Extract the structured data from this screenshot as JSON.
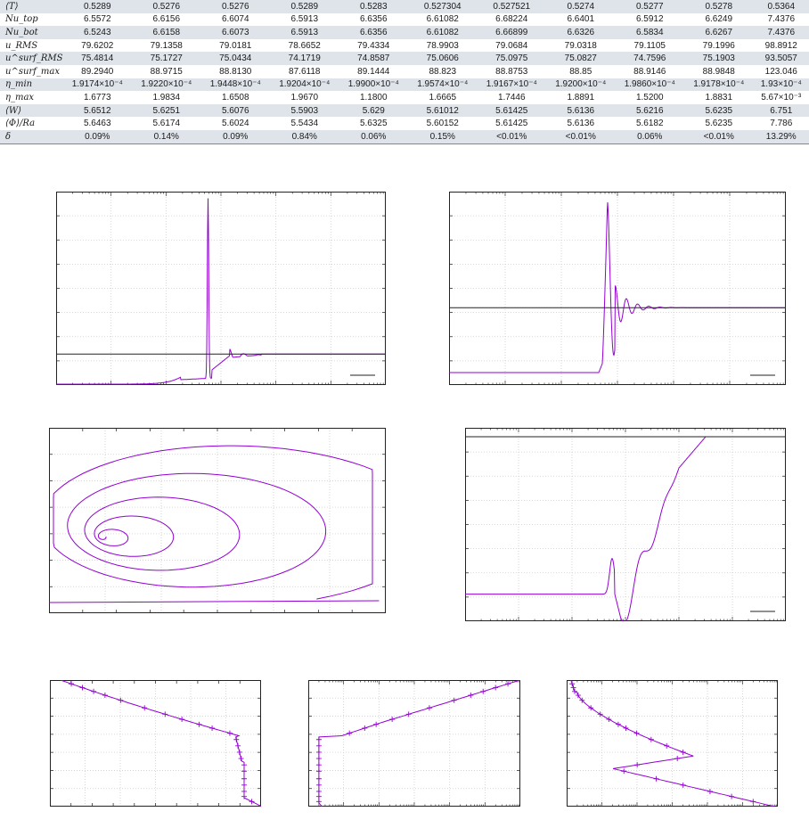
{
  "table": {
    "rows": [
      {
        "label": "⟨T⟩",
        "values": [
          "0.5289",
          "0.5276",
          "0.5276",
          "0.5289",
          "0.5283",
          "0.527304",
          "0.527521",
          "0.5274",
          "0.5277",
          "0.5278",
          "0.5364"
        ]
      },
      {
        "label": "Nu_top",
        "values": [
          "6.5572",
          "6.6156",
          "6.6074",
          "6.5913",
          "6.6356",
          "6.61082",
          "6.68224",
          "6.6401",
          "6.5912",
          "6.6249",
          "7.4376"
        ]
      },
      {
        "label": "Nu_bot",
        "values": [
          "6.5243",
          "6.6158",
          "6.6073",
          "6.5913",
          "6.6356",
          "6.61082",
          "6.66899",
          "6.6326",
          "6.5834",
          "6.6267",
          "7.4376"
        ]
      },
      {
        "label": "u_RMS",
        "values": [
          "79.6202",
          "79.1358",
          "79.0181",
          "78.6652",
          "79.4334",
          "78.9903",
          "79.0684",
          "79.0318",
          "79.1105",
          "79.1996",
          "98.8912"
        ]
      },
      {
        "label": "u^surf_RMS",
        "values": [
          "75.4814",
          "75.1727",
          "75.0434",
          "74.1719",
          "74.8587",
          "75.0606",
          "75.0975",
          "75.0827",
          "74.7596",
          "75.1903",
          "93.5057"
        ]
      },
      {
        "label": "u^surf_max",
        "values": [
          "89.2940",
          "88.9715",
          "88.8130",
          "87.6118",
          "89.1444",
          "88.823",
          "88.8753",
          "88.85",
          "88.9146",
          "88.9848",
          "123.046"
        ]
      },
      {
        "label": "η_min",
        "values": [
          "1.9174×10⁻⁴",
          "1.9220×10⁻⁴",
          "1.9448×10⁻⁴",
          "1.9204×10⁻⁴",
          "1.9900×10⁻⁴",
          "1.9574×10⁻⁴",
          "1.9167×10⁻⁴",
          "1.9200×10⁻⁴",
          "1.9860×10⁻⁴",
          "1.9178×10⁻⁴",
          "1.93×10⁻⁴"
        ]
      },
      {
        "label": "η_max",
        "values": [
          "1.6773",
          "1.9834",
          "1.6508",
          "1.9670",
          "1.1800",
          "1.6665",
          "1.7446",
          "1.8891",
          "1.5200",
          "1.8831",
          "5.67×10⁻³"
        ]
      },
      {
        "label": "⟨W⟩",
        "values": [
          "5.6512",
          "5.6251",
          "5.6076",
          "5.5903",
          "5.629",
          "5.61012",
          "5.61425",
          "5.6136",
          "5.6216",
          "5.6235",
          "6.751"
        ]
      },
      {
        "label": "⟨Φ⟩/Ra",
        "values": [
          "5.6463",
          "5.6174",
          "5.6024",
          "5.5434",
          "5.6325",
          "5.60152",
          "5.61425",
          "5.6136",
          "5.6182",
          "5.6235",
          "7.786"
        ]
      },
      {
        "label": "δ",
        "values": [
          "0.09%",
          "0.14%",
          "0.09%",
          "0.84%",
          "0.06%",
          "0.15%",
          "<0.01%",
          "<0.01%",
          "0.06%",
          "<0.01%",
          "13.29%"
        ]
      }
    ]
  },
  "chart_data": [
    {
      "id": "plot-a",
      "type": "line",
      "xscale": "log",
      "grid": true,
      "legend": "bottom-right",
      "legend_swatch_color": "#222222",
      "series_colors": [
        "#9400d3",
        "#222222"
      ],
      "note": "spike-and-damped-oscillation time series with horizontal reference line"
    },
    {
      "id": "plot-b",
      "type": "line",
      "xscale": "log",
      "grid": true,
      "legend": "bottom-right",
      "legend_swatch_color": "#222222",
      "series_colors": [
        "#9400d3",
        "#222222"
      ],
      "note": "step rise then damped oscillation to steady value"
    },
    {
      "id": "plot-c",
      "type": "line",
      "xscale": "linear",
      "grid": true,
      "series_colors": [
        "#9400d3"
      ],
      "note": "phase-space spiral"
    },
    {
      "id": "plot-d",
      "type": "line",
      "xscale": "log",
      "grid": true,
      "legend": "bottom-right",
      "legend_swatch_color": "#222222",
      "series_colors": [
        "#9400d3",
        "#222222"
      ],
      "note": "dip then oscillating rise to plateau"
    },
    {
      "id": "profile-1",
      "type": "line",
      "markers": "plus",
      "grid": true,
      "series_colors": [
        "#9400d3"
      ]
    },
    {
      "id": "profile-2",
      "type": "line",
      "markers": "plus",
      "xscale": "log",
      "grid": true,
      "series_colors": [
        "#9400d3"
      ]
    },
    {
      "id": "profile-3",
      "type": "line",
      "markers": "plus",
      "xscale": "log",
      "grid": true,
      "series_colors": [
        "#9400d3"
      ]
    }
  ]
}
